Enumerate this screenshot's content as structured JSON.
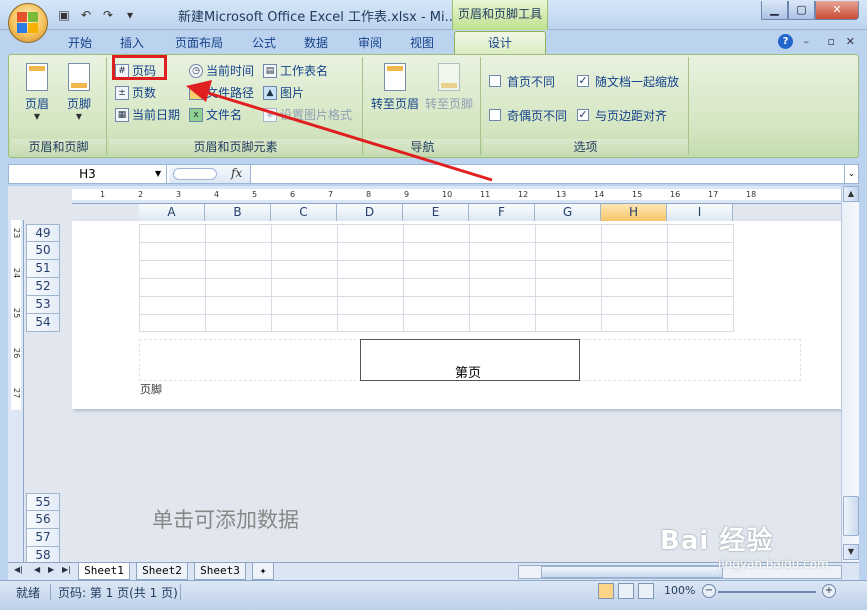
{
  "title_bar": {
    "title": "新建Microsoft Office Excel 工作表.xlsx - Mi...",
    "context_tab_title": "页眉和页脚工具"
  },
  "tabs": [
    {
      "label": "开始"
    },
    {
      "label": "插入"
    },
    {
      "label": "页面布局"
    },
    {
      "label": "公式"
    },
    {
      "label": "数据"
    },
    {
      "label": "审阅"
    },
    {
      "label": "视图"
    },
    {
      "label": "设计"
    }
  ],
  "ribbon": {
    "group1": {
      "header_btn": "页眉",
      "footer_btn": "页脚",
      "label": "页眉和页脚"
    },
    "group2": {
      "page_number": "页码",
      "page_count": "页数",
      "current_date": "当前日期",
      "current_time": "当前时间",
      "file_path": "文件路径",
      "file_name": "文件名",
      "sheet_name": "工作表名",
      "picture": "图片",
      "format_picture": "设置图片格式",
      "label": "页眉和页脚元素"
    },
    "group3": {
      "goto_header": "转至页眉",
      "goto_footer": "转至页脚",
      "label": "导航"
    },
    "group4": {
      "first_page_diff": "首页不同",
      "odd_even_diff": "奇偶页不同",
      "scale_with_doc": "随文档一起缩放",
      "align_margins": "与页边距对齐",
      "label": "选项"
    }
  },
  "formula_bar": {
    "name_box": "H3",
    "fx": "fx"
  },
  "columns": [
    "A",
    "B",
    "C",
    "D",
    "E",
    "F",
    "G",
    "H",
    "I"
  ],
  "rows_page1": [
    "49",
    "50",
    "51",
    "52",
    "53",
    "54"
  ],
  "rows_page2": [
    "55",
    "56",
    "57",
    "58"
  ],
  "ruler_v": [
    "23",
    "24",
    "25",
    "26",
    "27"
  ],
  "ruler_h": [
    "1",
    "2",
    "3",
    "4",
    "5",
    "6",
    "7",
    "8",
    "9",
    "10",
    "11",
    "12",
    "13",
    "14",
    "15",
    "16",
    "17",
    "18"
  ],
  "footer": {
    "center_text": "第页",
    "label": "页脚"
  },
  "page2_hint": "单击可添加数据",
  "sheets": [
    {
      "label": "Sheet1"
    },
    {
      "label": "Sheet2"
    },
    {
      "label": "Sheet3"
    }
  ],
  "status": {
    "ready": "就绪",
    "page_info": "页码: 第 1 页(共 1 页)",
    "zoom": "100%"
  },
  "watermark": {
    "main": "Bai 经验",
    "sub": "jingyan.baidu.com"
  }
}
